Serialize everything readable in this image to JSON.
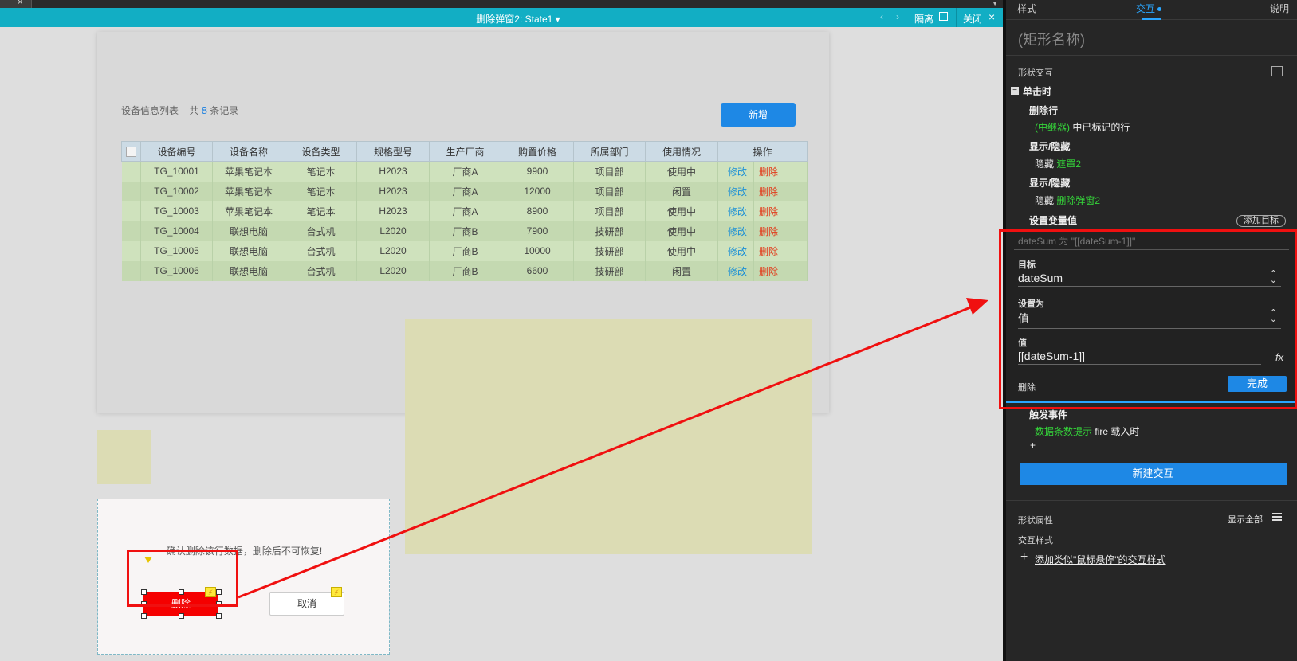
{
  "header": {
    "title": "删除弹窗2: State1",
    "isolate_label": "隔离",
    "close_label": "关闭",
    "prev_icon": "chevron-left-icon",
    "next_icon": "chevron-right-icon"
  },
  "canvas": {
    "list": {
      "title": "设备信息列表",
      "total_prefix": "共",
      "count": "8",
      "total_suffix": "条记录",
      "add_button": "新增"
    },
    "table": {
      "headers": [
        "设备编号",
        "设备名称",
        "设备类型",
        "规格型号",
        "生产厂商",
        "购置价格",
        "所属部门",
        "使用情况",
        "操作"
      ],
      "rows": [
        [
          "TG_10001",
          "苹果笔记本",
          "笔记本",
          "H2023",
          "厂商A",
          "9900",
          "项目部",
          "使用中"
        ],
        [
          "TG_10002",
          "苹果笔记本",
          "笔记本",
          "H2023",
          "厂商A",
          "12000",
          "项目部",
          "闲置"
        ],
        [
          "TG_10003",
          "苹果笔记本",
          "笔记本",
          "H2023",
          "厂商A",
          "8900",
          "项目部",
          "使用中"
        ],
        [
          "TG_10004",
          "联想电脑",
          "台式机",
          "L2020",
          "厂商B",
          "7900",
          "技研部",
          "使用中"
        ],
        [
          "TG_10005",
          "联想电脑",
          "台式机",
          "L2020",
          "厂商B",
          "10000",
          "技研部",
          "使用中"
        ],
        [
          "TG_10006",
          "联想电脑",
          "台式机",
          "L2020",
          "厂商B",
          "6600",
          "技研部",
          "闲置"
        ]
      ],
      "edit_label": "修改",
      "delete_label": "删除"
    },
    "dialog": {
      "message": "确认删除该行数据，删除后不可恢复!",
      "delete_button": "删除",
      "cancel_button": "取消"
    }
  },
  "right_panel": {
    "tabs": [
      "样式",
      "交互",
      "说明"
    ],
    "shape_name": "(矩形名称)",
    "section_title": "形状交互",
    "event": "单击时",
    "actions": {
      "delete_row": "删除行",
      "delete_row_target_green": "(中继器)",
      "delete_row_target_text": "中已标记的行",
      "show_hide_1": "显示/隐藏",
      "hide_1_prefix": "隐藏",
      "hide_1_target": "遮罩2",
      "show_hide_2": "显示/隐藏",
      "hide_2_prefix": "隐藏",
      "hide_2_target": "删除弹窗2",
      "set_var": "设置变量值",
      "add_target": "添加目标"
    },
    "editor": {
      "hint": "dateSum 为 \"[[dateSum-1]]\"",
      "target_label": "目标",
      "target_value": "dateSum",
      "set_to_label": "设置为",
      "set_to_value": "值",
      "value_label": "值",
      "value_value": "[[dateSum-1]]",
      "delete_label": "删除",
      "done_button": "完成"
    },
    "trigger": {
      "title": "触发事件",
      "target_green": "数据条数提示",
      "target_text": "fire 载入时"
    },
    "add_plus": "+",
    "new_interaction": "新建交互",
    "shape_props": "形状属性",
    "show_all": "显示全部",
    "inter_style_title": "交互样式",
    "add_style_link": "添加类似\"鼠标悬停\"的交互样式"
  },
  "colors": {
    "header_bg": "#12aec4",
    "accent_blue": "#1e88e5",
    "danger_red": "#f50000",
    "highlight_red": "#f01010",
    "green_text": "#35d63a"
  }
}
